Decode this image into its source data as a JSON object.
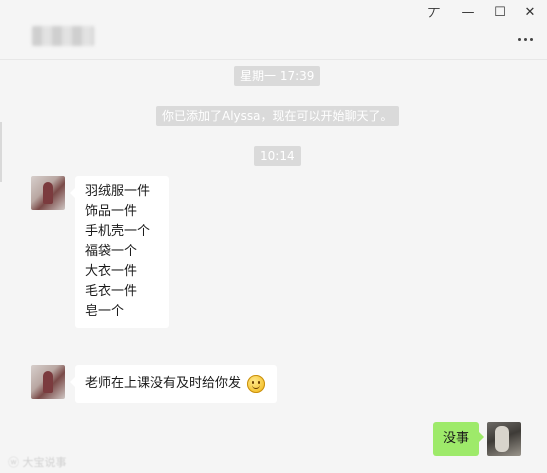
{
  "window": {
    "pin_glyph": "丆",
    "minimize_glyph": "—",
    "maximize_glyph": "☐",
    "close_glyph": "✕",
    "more_icon": "ellipsis-icon"
  },
  "chat": {
    "contact_name": "",
    "messages": [
      {
        "type": "time",
        "text": "星期一 17:39"
      },
      {
        "type": "system",
        "text": "你已添加了Alyssa，现在可以开始聊天了。"
      },
      {
        "type": "time",
        "text": "10:14"
      },
      {
        "type": "received",
        "lines": [
          "羽绒服一件",
          "饰品一件",
          "手机壳一个",
          "福袋一个",
          "大衣一件",
          "毛衣一件",
          "皂一个"
        ]
      },
      {
        "type": "received",
        "text": "老师在上课没有及时给你发",
        "emoji": "smiley"
      },
      {
        "type": "sent",
        "text": "没事"
      }
    ]
  },
  "watermark": "大宝说事",
  "colors": {
    "background": "#f5f5f5",
    "sent_bubble": "#9eea6a",
    "received_bubble": "#ffffff",
    "time_pill": "#dadada"
  }
}
